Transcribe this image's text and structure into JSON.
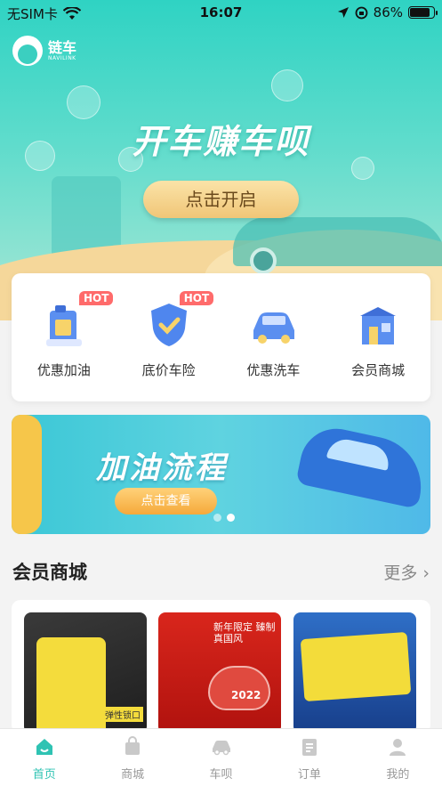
{
  "status_bar": {
    "carrier": "无SIM卡",
    "time": "16:07",
    "battery_percent": "86%",
    "battery_level": 0.86
  },
  "header": {
    "app_name": "链车",
    "app_subtitle": "NAVILINK"
  },
  "hero": {
    "slogan": "开车赚车呗",
    "button_label": "点击开启"
  },
  "services": [
    {
      "label": "优惠加油",
      "badge": "HOT",
      "icon": "fuel-can-icon"
    },
    {
      "label": "底价车险",
      "badge": "HOT",
      "icon": "shield-check-icon"
    },
    {
      "label": "优惠洗车",
      "badge": "",
      "icon": "car-wash-icon"
    },
    {
      "label": "会员商城",
      "badge": "",
      "icon": "store-icon"
    }
  ],
  "banner": {
    "title": "加油流程",
    "button_label": "点击查看",
    "page_count": 2,
    "active_page": 2
  },
  "mall_section": {
    "title": "会员商城",
    "more_label": "更多"
  },
  "products": [
    {
      "image": "car-trash-bag",
      "tag_text": "弹性锁口"
    },
    {
      "image": "new-year-mask",
      "overlay_text": "新年限定 臻制真国风",
      "number": "2022"
    },
    {
      "image": "car-towel"
    }
  ],
  "tabbar": {
    "items": [
      {
        "label": "首页",
        "icon": "home-icon",
        "active": true
      },
      {
        "label": "商城",
        "icon": "shopping-bag-icon",
        "active": false
      },
      {
        "label": "车呗",
        "icon": "car-icon",
        "active": false
      },
      {
        "label": "订单",
        "icon": "order-list-icon",
        "active": false
      },
      {
        "label": "我的",
        "icon": "user-icon",
        "active": false
      }
    ]
  },
  "colors": {
    "accent": "#2fc3b3",
    "hot_badge": "#ff6b6b",
    "hero_button": "#f0c677"
  }
}
